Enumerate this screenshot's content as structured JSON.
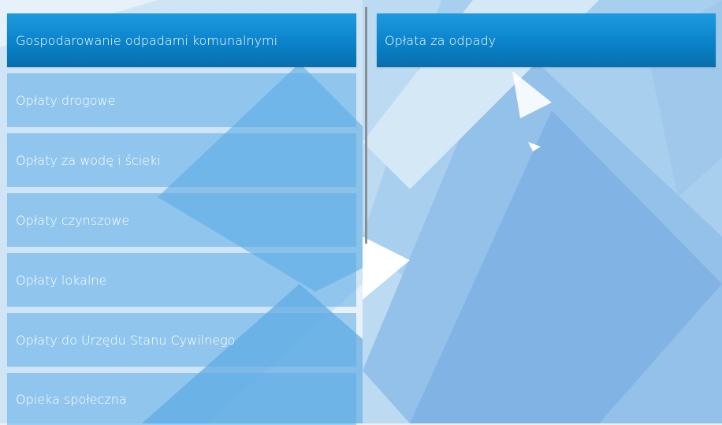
{
  "colors": {
    "active_button": "#0a82c9",
    "inactive_button": "#5cade6",
    "divider": "#8a8f94",
    "background": "#e8f2fa"
  },
  "categories": [
    {
      "label": "Gospodarowanie odpadami komunalnymi",
      "active": true
    },
    {
      "label": "Opłaty drogowe",
      "active": false
    },
    {
      "label": "Opłaty za wodę i ścieki",
      "active": false
    },
    {
      "label": "Opłaty czynszowe",
      "active": false
    },
    {
      "label": "Opłaty lokalne",
      "active": false
    },
    {
      "label": "Opłaty do Urzędu Stanu Cywilnego",
      "active": false
    },
    {
      "label": "Opieka społeczna",
      "active": false
    }
  ],
  "subcategories": [
    {
      "label": "Opłata za odpady"
    }
  ]
}
